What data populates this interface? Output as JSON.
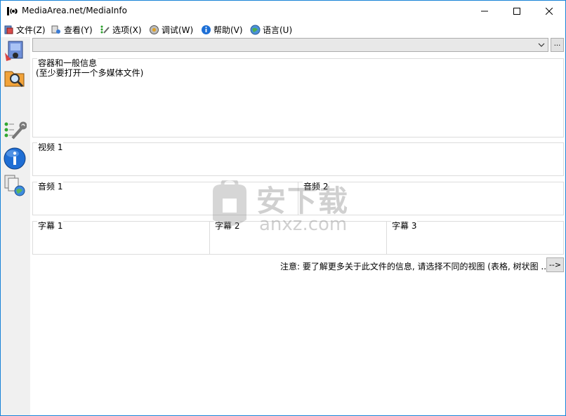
{
  "window": {
    "title": "MediaArea.net/MediaInfo"
  },
  "menu": {
    "file": "文件(Z)",
    "view": "查看(Y)",
    "options": "选项(X)",
    "debug": "调试(W)",
    "help": "帮助(V)",
    "language": "语言(U)"
  },
  "toolbar": {
    "browse_label": "..."
  },
  "sections": {
    "general": {
      "title": "容器和一般信息",
      "body": "(至少要打开一个多媒体文件)"
    },
    "video": {
      "title": "视频 1"
    },
    "audio1": {
      "title": "音频 1"
    },
    "audio2": {
      "title": "音频 2"
    },
    "text1": {
      "title": "字幕 1"
    },
    "text2": {
      "title": "字幕 2"
    },
    "text3": {
      "title": "字幕 3"
    }
  },
  "note": {
    "text": "注意: 要了解更多关于此文件的信息, 请选择不同的视图 (表格, 树状图 ...)",
    "button": "-->"
  },
  "watermark": {
    "text1": "安下载",
    "text2": "anxz.com"
  },
  "colors": {
    "window_border": "#1883d7",
    "sidebar_bg": "#f0f0f0",
    "group_border": "#dcdcdc"
  }
}
